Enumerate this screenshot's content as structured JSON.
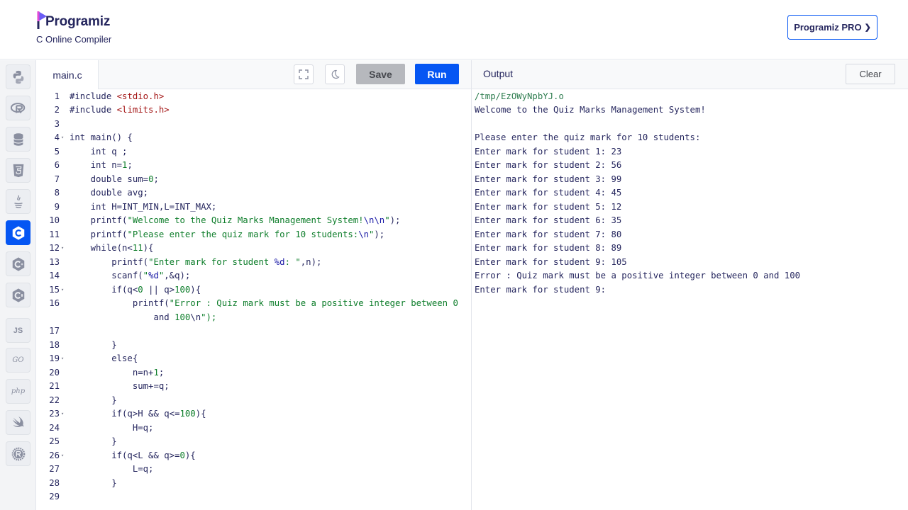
{
  "brand": {
    "logo_text": "Programiz",
    "subtitle": "C Online Compiler",
    "pro_label": "Programiz PRO",
    "accent": "#0556f3"
  },
  "sidebar": {
    "items": [
      {
        "name": "python-icon"
      },
      {
        "name": "r-icon"
      },
      {
        "name": "sql-icon"
      },
      {
        "name": "html5-icon"
      },
      {
        "name": "java-icon"
      },
      {
        "name": "c-icon",
        "active": true
      },
      {
        "name": "cpp-icon"
      },
      {
        "name": "csharp-icon"
      },
      {
        "name": "js-icon",
        "label": "JS"
      },
      {
        "name": "go-icon",
        "label": "GO"
      },
      {
        "name": "php-icon",
        "label": "php"
      },
      {
        "name": "swift-icon"
      },
      {
        "name": "rust-icon"
      }
    ]
  },
  "editor": {
    "file_name": "main.c",
    "save_label": "Save",
    "run_label": "Run",
    "lines": [
      {
        "n": "1",
        "code": "#include <stdio.h>"
      },
      {
        "n": "2",
        "code": "#include <limits.h>"
      },
      {
        "n": "3",
        "code": ""
      },
      {
        "n": "4",
        "code": "int main() {",
        "fold": true
      },
      {
        "n": "5",
        "code": "    int q ;"
      },
      {
        "n": "6",
        "code": "    int n=1;"
      },
      {
        "n": "7",
        "code": "    double sum=0;"
      },
      {
        "n": "8",
        "code": "    double avg;"
      },
      {
        "n": "9",
        "code": "    int H=INT_MIN,L=INT_MAX;"
      },
      {
        "n": "10",
        "code": "    printf(\"Welcome to the Quiz Marks Management System!\\n\\n\");"
      },
      {
        "n": "11",
        "code": "    printf(\"Please enter the quiz mark for 10 students:\\n\");"
      },
      {
        "n": "12",
        "code": "    while(n<11){",
        "fold": true
      },
      {
        "n": "13",
        "code": "        printf(\"Enter mark for student %d: \",n);"
      },
      {
        "n": "14",
        "code": "        scanf(\"%d\",&q);"
      },
      {
        "n": "15",
        "code": "        if(q<0 || q>100){",
        "fold": true
      },
      {
        "n": "16",
        "code": "            printf(\"Error : Quiz mark must be a positive integer between 0",
        "cont": "                and 100\\n\");"
      },
      {
        "n": "17",
        "code": ""
      },
      {
        "n": "18",
        "code": "        }"
      },
      {
        "n": "19",
        "code": "        else{",
        "fold": true
      },
      {
        "n": "20",
        "code": "            n=n+1;"
      },
      {
        "n": "21",
        "code": "            sum+=q;"
      },
      {
        "n": "22",
        "code": "        }"
      },
      {
        "n": "23",
        "code": "        if(q>H && q<=100){",
        "fold": true
      },
      {
        "n": "24",
        "code": "            H=q;"
      },
      {
        "n": "25",
        "code": "        }"
      },
      {
        "n": "26",
        "code": "        if(q<L && q>=0){",
        "fold": true
      },
      {
        "n": "27",
        "code": "            L=q;"
      },
      {
        "n": "28",
        "code": "        }"
      },
      {
        "n": "29",
        "code": ""
      }
    ]
  },
  "output": {
    "title": "Output",
    "clear_label": "Clear",
    "lines": [
      "/tmp/EzOWyNpbYJ.o",
      "Welcome to the Quiz Marks Management System!",
      "",
      "Please enter the quiz mark for 10 students:",
      "Enter mark for student 1: 23",
      "Enter mark for student 2: 56",
      "Enter mark for student 3: 99",
      "Enter mark for student 4: 45",
      "Enter mark for student 5: 12",
      "Enter mark for student 6: 35",
      "Enter mark for student 7: 80",
      "Enter mark for student 8: 89",
      "Enter mark for student 9: 105",
      "Error : Quiz mark must be a positive integer between 0 and 100",
      "Enter mark for student 9:"
    ]
  }
}
